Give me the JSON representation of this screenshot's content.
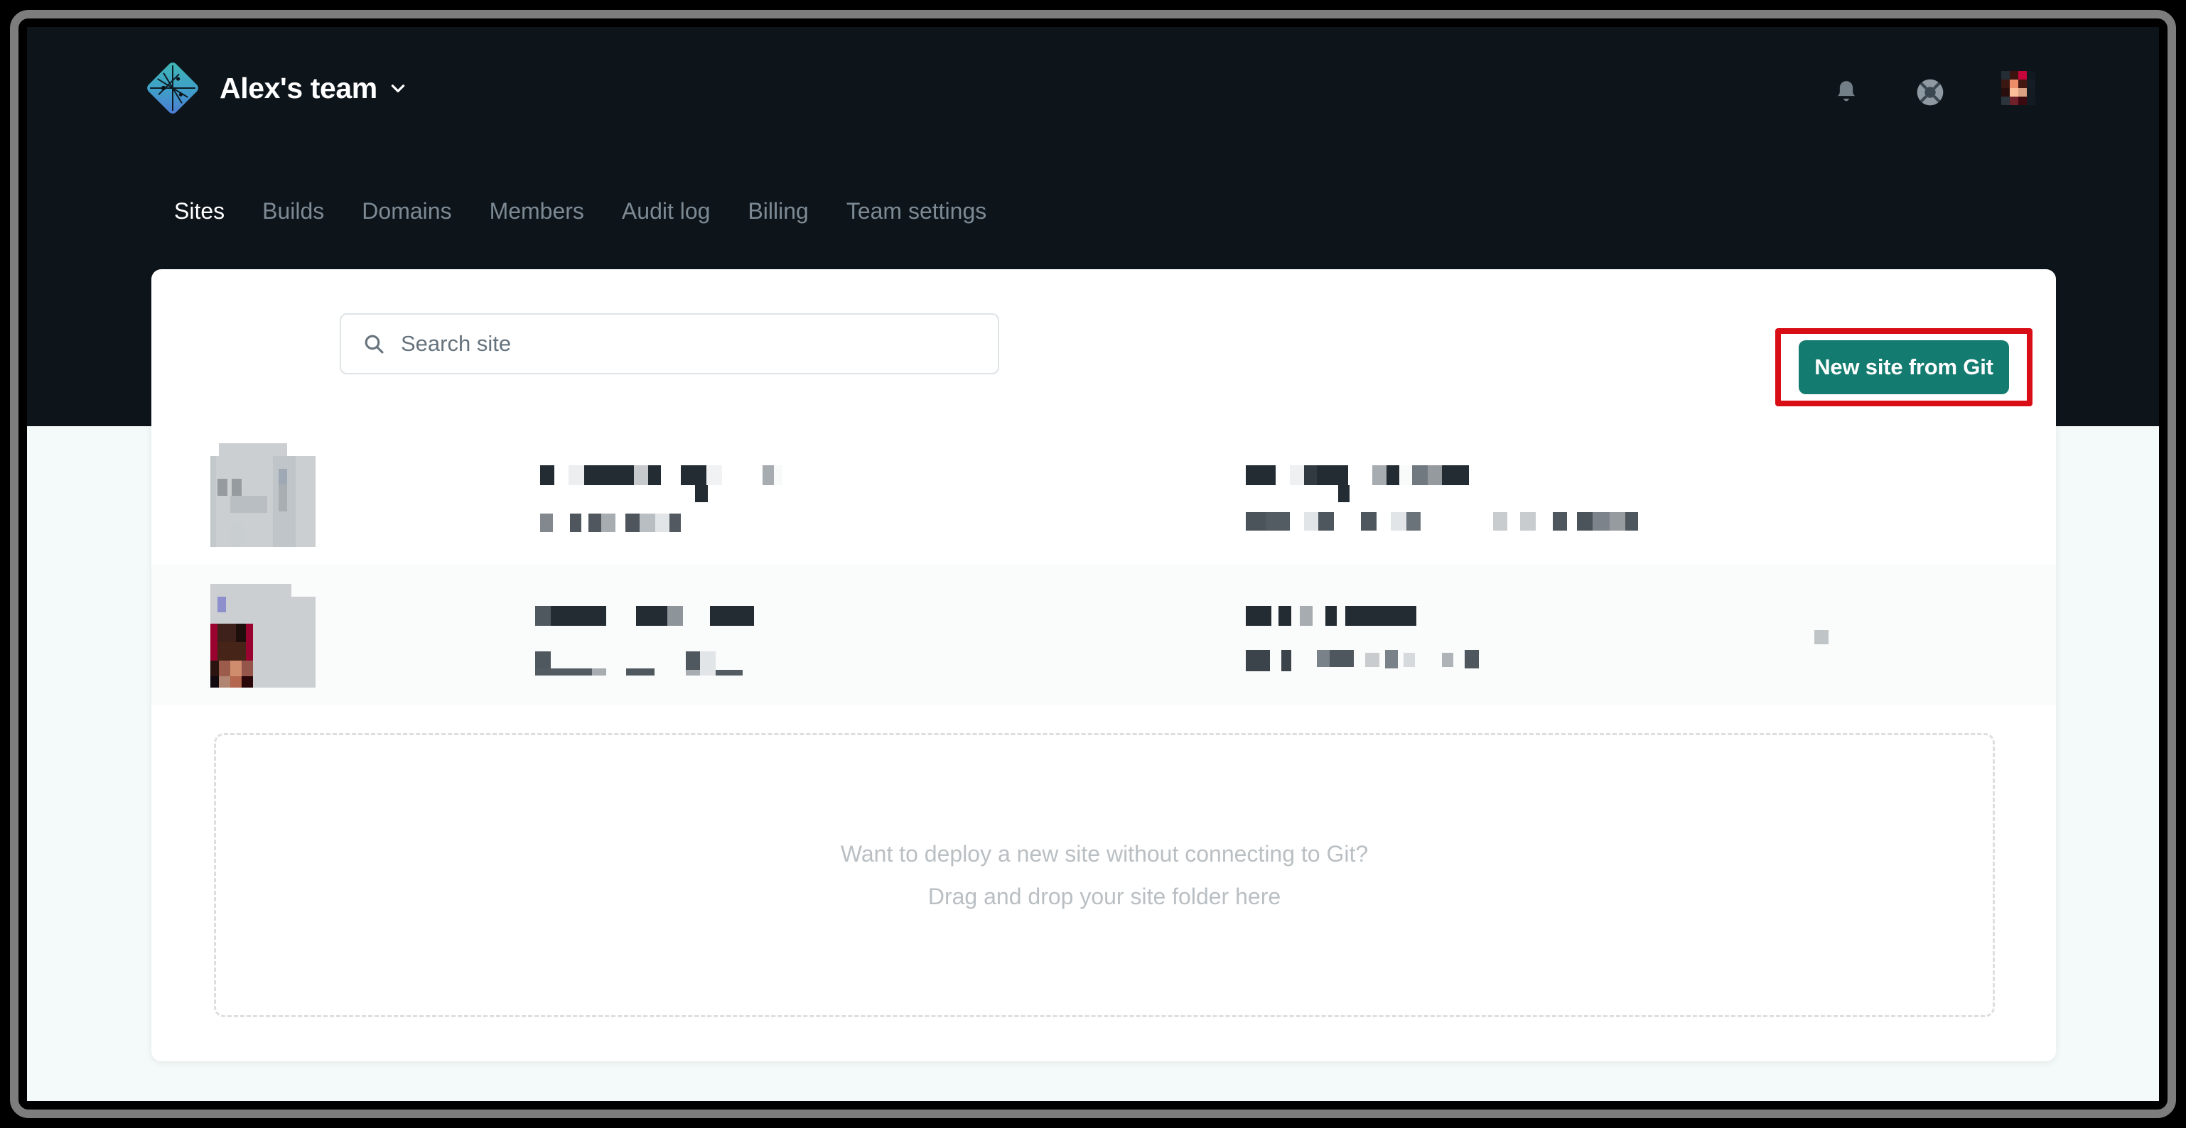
{
  "window": {
    "frame_color": "#7d7d7d",
    "background": "#f4faf9"
  },
  "header": {
    "background": "#0d141a",
    "logo_icon": "netlify-diamond-logo",
    "team_name": "Alex's team",
    "team_switcher_icon": "chevron-down-icon",
    "actions": [
      {
        "name": "notifications-button",
        "icon": "bell-icon",
        "label": ""
      },
      {
        "name": "help-button",
        "icon": "life-ring-icon",
        "label": ""
      },
      {
        "name": "account-avatar",
        "icon": "avatar-image",
        "label": ""
      }
    ]
  },
  "nav": {
    "tabs": [
      {
        "label": "Sites",
        "active": true
      },
      {
        "label": "Builds",
        "active": false
      },
      {
        "label": "Domains",
        "active": false
      },
      {
        "label": "Members",
        "active": false
      },
      {
        "label": "Audit log",
        "active": false
      },
      {
        "label": "Billing",
        "active": false
      },
      {
        "label": "Team settings",
        "active": false
      }
    ],
    "active_color": "#ffffff",
    "inactive_color": "#7d8a94"
  },
  "toolbar": {
    "search": {
      "placeholder": "Search site",
      "value": "",
      "icon": "search-icon"
    },
    "new_site_button": {
      "label": "New site from Git",
      "color": "#137b6f",
      "highlighted": true,
      "highlight_color": "#d80d15"
    }
  },
  "sites": {
    "rows": [
      {
        "name": "site-row-1",
        "redacted": true,
        "background": "#ffffff"
      },
      {
        "name": "site-row-2",
        "redacted": true,
        "background": "#fafbfb"
      }
    ]
  },
  "dropzone": {
    "line1": "Want to deploy a new site without connecting to Git?",
    "line2": "Drag and drop your site folder here",
    "text_color": "#b9bfc3",
    "border_color": "#dedede"
  }
}
